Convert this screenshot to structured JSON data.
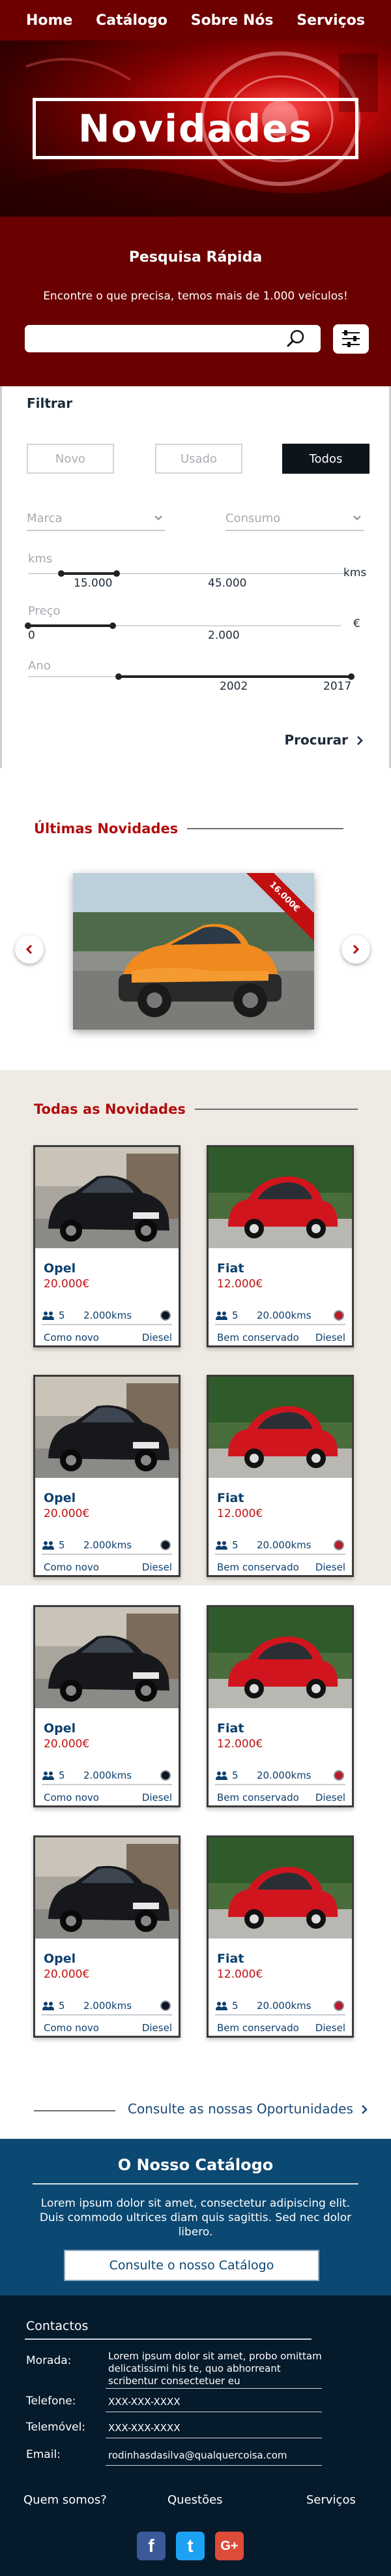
{
  "nav": {
    "items": [
      "Home",
      "Catálogo",
      "Sobre Nós",
      "Serviços"
    ]
  },
  "hero": {
    "title": "Novidades"
  },
  "quick_search": {
    "title": "Pesquisa Rápida",
    "subtitle": "Encontre o que precisa, temos mais de 1.000 veículos!",
    "placeholder": ""
  },
  "filter": {
    "title": "Filtrar",
    "condition_options": [
      "Novo",
      "Usado",
      "Todos"
    ],
    "selected_condition": "Todos",
    "brand_placeholder": "Marca",
    "consumption_placeholder": "Consumo",
    "kms": {
      "label": "kms",
      "unit": "kms",
      "min": "15.000",
      "max": "45.000",
      "min_fraction": 0.1,
      "max_fraction": 0.27
    },
    "price": {
      "label": "Preço",
      "unit": "€",
      "min": "0",
      "max": "2.000",
      "min_fraction": 0.0,
      "max_fraction": 0.27
    },
    "year": {
      "label": "Ano",
      "min": "2002",
      "max": "2017",
      "min_fraction": 0.28,
      "max_fraction": 1.0
    },
    "search_label": "Procurar"
  },
  "latest": {
    "title": "Últimas Novidades",
    "featured_badge": "16.000€",
    "prev_icon": "chevron-left-icon",
    "next_icon": "chevron-right-icon"
  },
  "all_listings": {
    "title": "Todas as Novidades",
    "cards": [
      {
        "brand": "Opel",
        "price": "20.000€",
        "seats": "5",
        "kms": "2.000kms",
        "color": "#0c1524",
        "condition": "Como novo",
        "fuel": "Diesel",
        "kind": "opel"
      },
      {
        "brand": "Fiat",
        "price": "12.000€",
        "seats": "5",
        "kms": "20.000kms",
        "color": "#b81c2c",
        "condition": "Bem conservado",
        "fuel": "Diesel",
        "kind": "fiat"
      },
      {
        "brand": "Opel",
        "price": "20.000€",
        "seats": "5",
        "kms": "2.000kms",
        "color": "#0c1524",
        "condition": "Como novo",
        "fuel": "Diesel",
        "kind": "opel"
      },
      {
        "brand": "Fiat",
        "price": "12.000€",
        "seats": "5",
        "kms": "20.000kms",
        "color": "#b81c2c",
        "condition": "Bem conservado",
        "fuel": "Diesel",
        "kind": "fiat"
      },
      {
        "brand": "Opel",
        "price": "20.000€",
        "seats": "5",
        "kms": "2.000kms",
        "color": "#0c1524",
        "condition": "Como novo",
        "fuel": "Diesel",
        "kind": "opel"
      },
      {
        "brand": "Fiat",
        "price": "12.000€",
        "seats": "5",
        "kms": "20.000kms",
        "color": "#b81c2c",
        "condition": "Bem conservado",
        "fuel": "Diesel",
        "kind": "fiat"
      },
      {
        "brand": "Opel",
        "price": "20.000€",
        "seats": "5",
        "kms": "2.000kms",
        "color": "#0c1524",
        "condition": "Como novo",
        "fuel": "Diesel",
        "kind": "opel"
      },
      {
        "brand": "Fiat",
        "price": "12.000€",
        "seats": "5",
        "kms": "20.000kms",
        "color": "#b81c2c",
        "condition": "Bem conservado",
        "fuel": "Diesel",
        "kind": "fiat"
      }
    ],
    "opportunities_link": "Consulte as nossas Oportunidades"
  },
  "catalog": {
    "title": "O Nosso Catálogo",
    "text": "Lorem ipsum dolor sit amet, consectetur adipiscing elit. Duis commodo ultrices diam quis sagittis. Sed nec dolor libero.",
    "button": "Consulte o nosso Catálogo"
  },
  "footer": {
    "contacts_title": "Contactos",
    "address_label": "Morada:",
    "address_value": "Lorem ipsum dolor sit amet, probo omittam delicatissimi his te, quo abhorreant scribentur consectetuer eu",
    "phone_label": "Telefone:",
    "phone_value": "XXX-XXX-XXXX",
    "mobile_label": "Telemóvel:",
    "mobile_value": "XXX-XXX-XXXX",
    "email_label": "Email:",
    "email_value": "rodinhasdasilva@qualquercoisa.com",
    "links": [
      "Quem somos?",
      "Questões",
      "Serviços"
    ],
    "social": [
      {
        "name": "facebook-icon",
        "glyph": "f",
        "color": "#3b5998"
      },
      {
        "name": "twitter-icon",
        "glyph": "t",
        "color": "#1da1f2"
      },
      {
        "name": "google-plus-icon",
        "glyph": "G+",
        "color": "#dd4b39"
      }
    ]
  }
}
